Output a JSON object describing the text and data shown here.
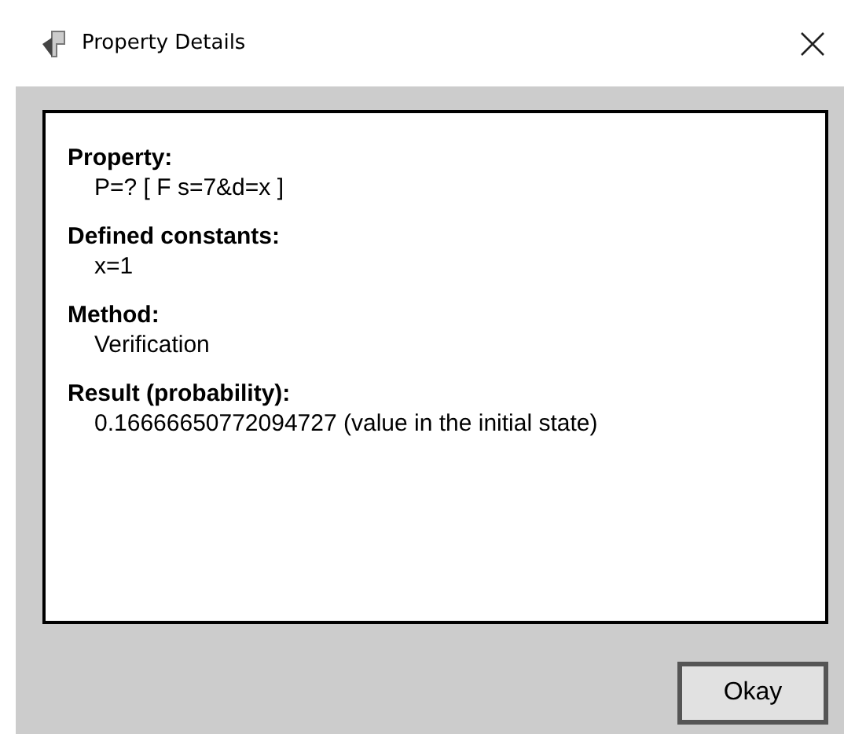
{
  "window": {
    "title": "Property Details"
  },
  "sections": [
    {
      "heading": "Property:",
      "value": "P=? [ F s=7&d=x ]"
    },
    {
      "heading": "Defined constants:",
      "value": "x=1"
    },
    {
      "heading": "Method:",
      "value": "Verification"
    },
    {
      "heading": "Result (probability):",
      "value": "0.16666650772094727 (value in the initial state)"
    }
  ],
  "buttons": [
    "Okay"
  ]
}
